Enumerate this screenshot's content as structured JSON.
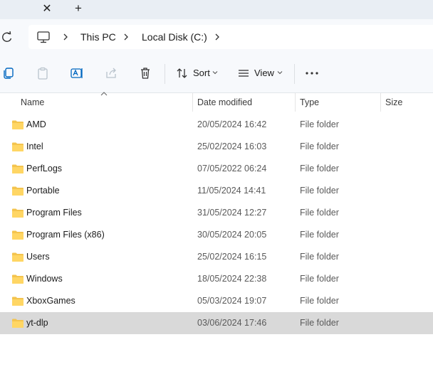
{
  "tabbar": {
    "close_glyph": "✕",
    "new_tab_glyph": "+"
  },
  "breadcrumb": {
    "items": [
      "This PC",
      "Local Disk (C:)"
    ]
  },
  "toolbar": {
    "sort_label": "Sort",
    "view_label": "View"
  },
  "columns": {
    "name": "Name",
    "date": "Date modified",
    "type": "Type",
    "size": "Size"
  },
  "files": [
    {
      "name": "AMD",
      "date": "20/05/2024 16:42",
      "type": "File folder"
    },
    {
      "name": "Intel",
      "date": "25/02/2024 16:03",
      "type": "File folder"
    },
    {
      "name": "PerfLogs",
      "date": "07/05/2022 06:24",
      "type": "File folder"
    },
    {
      "name": "Portable",
      "date": "11/05/2024 14:41",
      "type": "File folder"
    },
    {
      "name": "Program Files",
      "date": "31/05/2024 12:27",
      "type": "File folder"
    },
    {
      "name": "Program Files (x86)",
      "date": "30/05/2024 20:05",
      "type": "File folder"
    },
    {
      "name": "Users",
      "date": "25/02/2024 16:15",
      "type": "File folder"
    },
    {
      "name": "Windows",
      "date": "18/05/2024 22:38",
      "type": "File folder"
    },
    {
      "name": "XboxGames",
      "date": "05/03/2024 19:07",
      "type": "File folder"
    },
    {
      "name": "yt-dlp",
      "date": "03/06/2024 17:46",
      "type": "File folder",
      "selected": true
    }
  ],
  "colors": {
    "folder": "#f4c44e",
    "selection": "#d9d9d9",
    "accent": "#0067c0"
  }
}
